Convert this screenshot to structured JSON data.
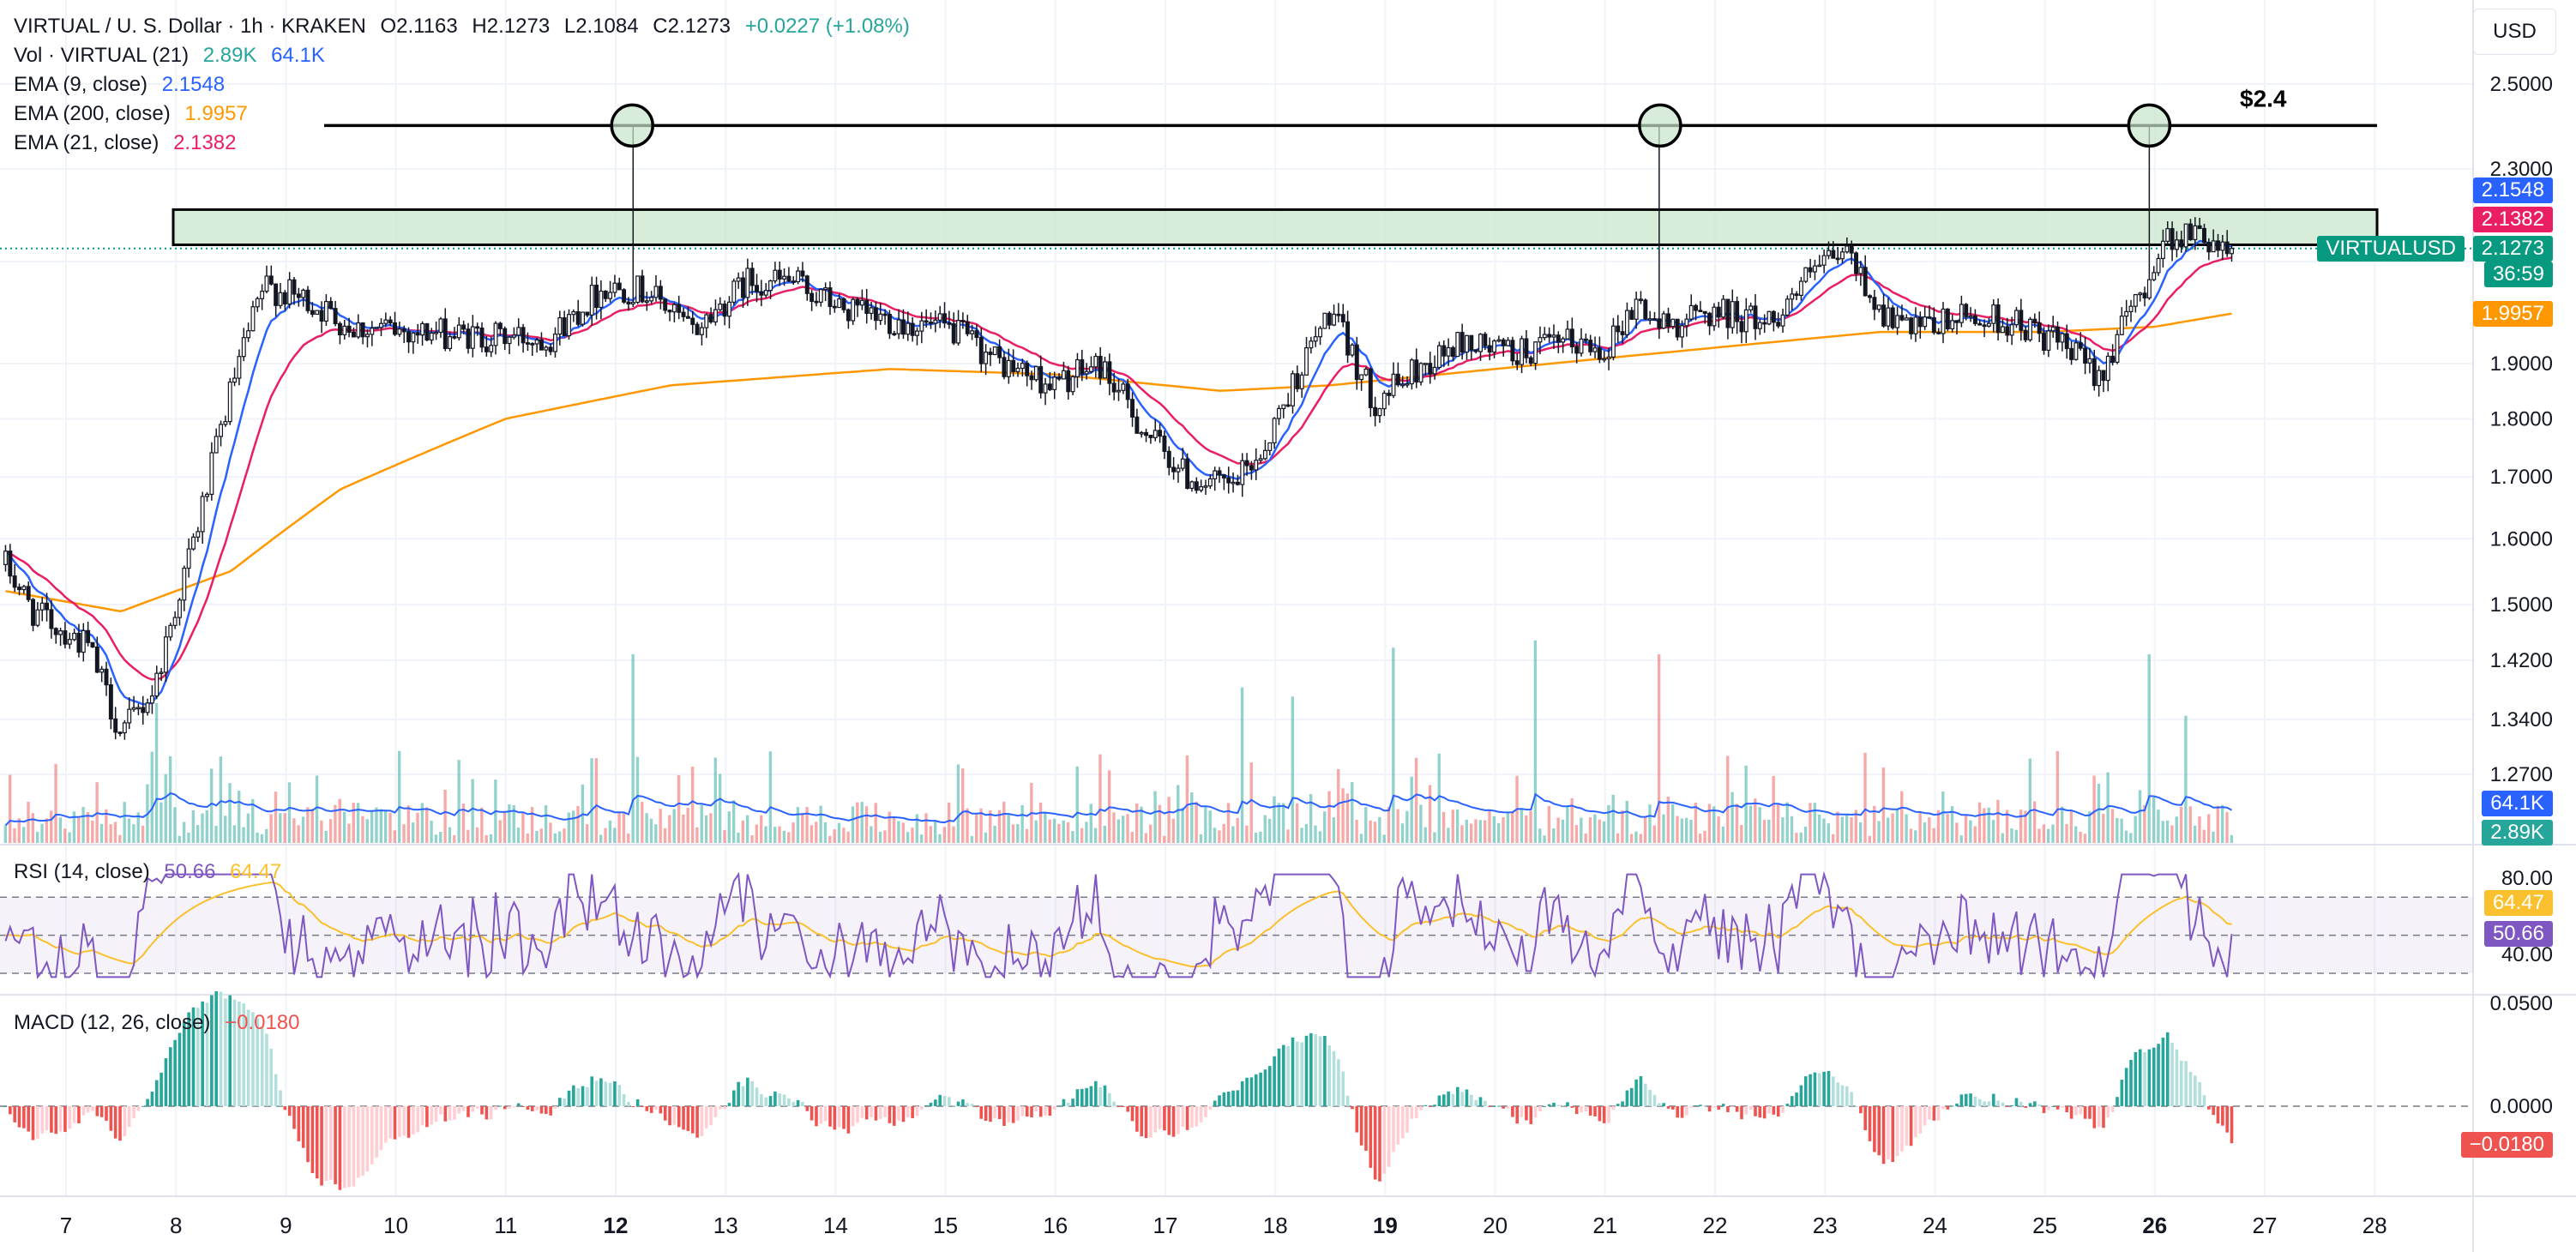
{
  "header": {
    "symbol": "VIRTUAL / U. S. Dollar · 1h · KRAKEN",
    "open": "O2.1163",
    "high": "H2.1273",
    "low": "L2.1084",
    "close": "C2.1273",
    "change": "+0.0227 (+1.08%)"
  },
  "currency_button": "USD",
  "legend": {
    "vol": {
      "label": "Vol · VIRTUAL (21)",
      "v1": "2.89K",
      "v2": "64.1K"
    },
    "ema9": {
      "label": "EMA (9, close)",
      "value": "2.1548"
    },
    "ema200": {
      "label": "EMA (200, close)",
      "value": "1.9957"
    },
    "ema21": {
      "label": "EMA (21, close)",
      "value": "2.1382"
    },
    "rsi": {
      "label": "RSI (14, close)",
      "v1": "50.66",
      "v2": "64.47"
    },
    "macd": {
      "label": "MACD (12, 26, close)",
      "value": "−0.0180"
    }
  },
  "badges": {
    "ema9": "2.1548",
    "ema21": "2.1382",
    "symbol": "VIRTUALUSD",
    "price": "2.1273",
    "countdown": "36:59",
    "ema200": "1.9957",
    "vol_ma": "64.1K",
    "vol": "2.89K",
    "rsi_ma": "64.47",
    "rsi": "50.66",
    "macd": "−0.0180"
  },
  "colors": {
    "up": "#26a69a",
    "down": "#ef5350",
    "ema9": "#2962ff",
    "ema21": "#e91e63",
    "ema200": "#ff9800",
    "rsi": "#7e57c2",
    "rsi_ma": "#fbc02d",
    "zone": "#c8e6c9"
  },
  "chart_data": {
    "type": "candlestick",
    "timeframe": "1h",
    "x_tick_labels": [
      "7",
      "8",
      "9",
      "10",
      "11",
      "12",
      "13",
      "14",
      "15",
      "16",
      "17",
      "18",
      "19",
      "20",
      "21",
      "22",
      "23",
      "24",
      "25",
      "26",
      "27",
      "28"
    ],
    "bold_x_ticks": [
      "12",
      "19",
      "26"
    ],
    "price_axis": {
      "ticks": [
        2.5,
        2.3,
        2.1,
        1.9,
        1.8,
        1.7,
        1.6,
        1.5,
        1.42,
        1.34,
        1.27
      ],
      "tick_labels": [
        "2.5000",
        "2.3000",
        "",
        "1.9000",
        "1.8000",
        "1.7000",
        "1.6000",
        "1.5000",
        "1.4200",
        "1.3400",
        "1.2700"
      ],
      "scale": "log"
    },
    "annotation": {
      "resistance_label": "$2.4",
      "resistance_price": 2.4,
      "zone_low": 2.135,
      "zone_high": 2.21,
      "marked_wicks_day": [
        12.15,
        21.5,
        25.95
      ]
    },
    "price_path_keypoints": [
      [
        6.45,
        1.56
      ],
      [
        6.7,
        1.49
      ],
      [
        6.9,
        1.47
      ],
      [
        7.2,
        1.44
      ],
      [
        7.5,
        1.32
      ],
      [
        7.8,
        1.38
      ],
      [
        8.2,
        1.62
      ],
      [
        8.5,
        1.85
      ],
      [
        8.8,
        2.05
      ],
      [
        9.2,
        2.02
      ],
      [
        9.6,
        1.97
      ],
      [
        10.2,
        1.96
      ],
      [
        10.8,
        1.95
      ],
      [
        11.4,
        1.95
      ],
      [
        11.9,
        2.05
      ],
      [
        12.3,
        2.04
      ],
      [
        12.7,
        1.96
      ],
      [
        13.2,
        2.06
      ],
      [
        13.6,
        2.06
      ],
      [
        14.1,
        2.0
      ],
      [
        14.6,
        1.98
      ],
      [
        15.1,
        1.96
      ],
      [
        15.5,
        1.9
      ],
      [
        16.0,
        1.86
      ],
      [
        16.4,
        1.9
      ],
      [
        16.8,
        1.78
      ],
      [
        17.2,
        1.7
      ],
      [
        17.6,
        1.68
      ],
      [
        17.9,
        1.75
      ],
      [
        18.2,
        1.88
      ],
      [
        18.5,
        2.0
      ],
      [
        18.9,
        1.83
      ],
      [
        19.3,
        1.89
      ],
      [
        19.7,
        1.94
      ],
      [
        20.2,
        1.92
      ],
      [
        20.7,
        1.94
      ],
      [
        21.0,
        1.93
      ],
      [
        21.3,
        2.02
      ],
      [
        21.5,
        1.97
      ],
      [
        22.0,
        2.0
      ],
      [
        22.5,
        1.98
      ],
      [
        22.9,
        2.08
      ],
      [
        23.2,
        2.12
      ],
      [
        23.5,
        2.0
      ],
      [
        23.8,
        1.96
      ],
      [
        24.3,
        1.99
      ],
      [
        24.7,
        1.98
      ],
      [
        25.1,
        1.94
      ],
      [
        25.5,
        1.88
      ],
      [
        25.9,
        2.05
      ],
      [
        26.1,
        2.15
      ],
      [
        26.4,
        2.16
      ],
      [
        26.7,
        2.1273
      ]
    ],
    "ema200_keypoints": [
      [
        6.45,
        1.52
      ],
      [
        7.5,
        1.49
      ],
      [
        8.5,
        1.55
      ],
      [
        9.5,
        1.68
      ],
      [
        11.0,
        1.8
      ],
      [
        12.5,
        1.86
      ],
      [
        14.5,
        1.89
      ],
      [
        16.0,
        1.88
      ],
      [
        17.5,
        1.85
      ],
      [
        18.5,
        1.86
      ],
      [
        20.0,
        1.89
      ],
      [
        22.0,
        1.93
      ],
      [
        23.5,
        1.96
      ],
      [
        25.0,
        1.96
      ],
      [
        26.0,
        1.97
      ],
      [
        26.7,
        1.9957
      ]
    ],
    "volume": {
      "ma_value": "64.1K",
      "last_value": "2.89K"
    },
    "rsi": {
      "upper": 70,
      "middle": 50,
      "lower": 30,
      "tick_labels": [
        "80.00",
        "40.00"
      ]
    },
    "macd": {
      "tick_labels": [
        "0.0500",
        "0.0000"
      ],
      "last_value": -0.018
    }
  }
}
